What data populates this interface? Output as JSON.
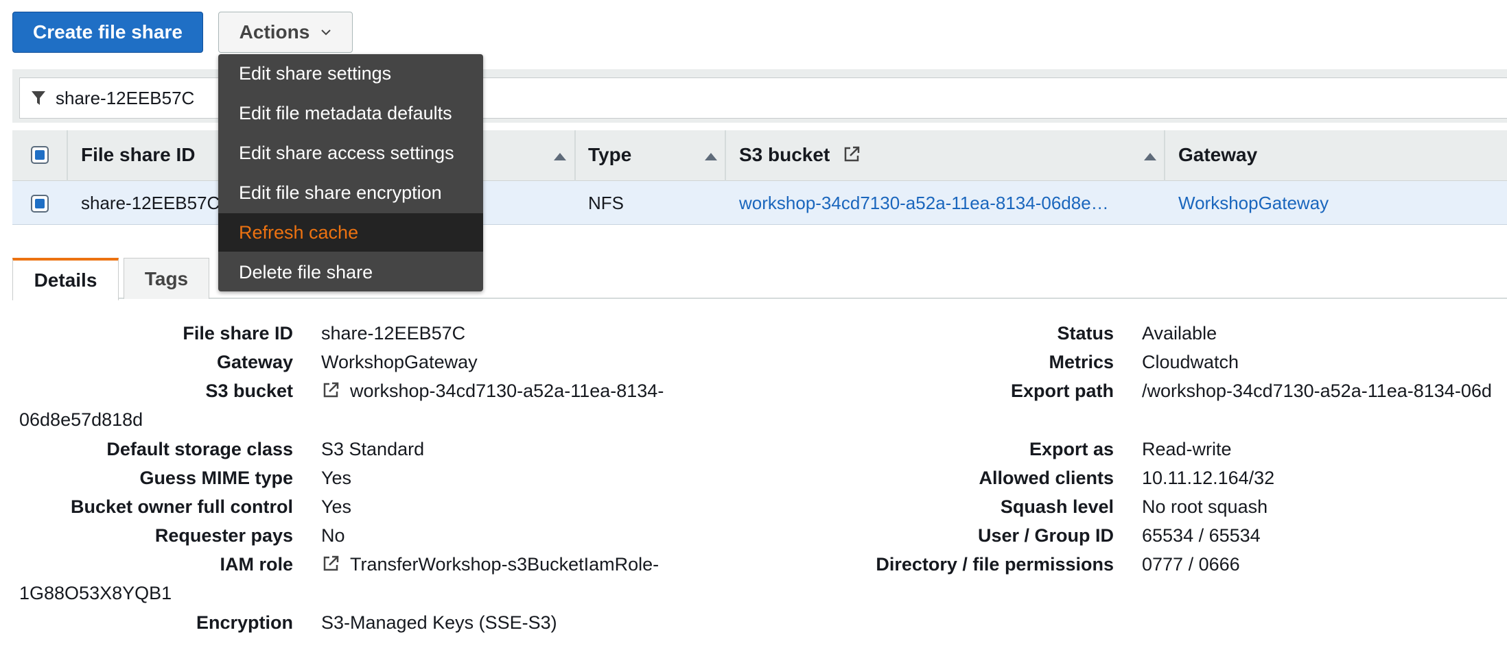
{
  "toolbar": {
    "create_label": "Create file share",
    "actions_label": "Actions"
  },
  "filter": {
    "value": "share-12EEB57C"
  },
  "table": {
    "headers": [
      "File share ID",
      "Type",
      "S3 bucket",
      "Gateway"
    ],
    "row": {
      "file_share_id": "share-12EEB57C",
      "type": "NFS",
      "s3_bucket": "workshop-34cd7130-a52a-11ea-8134-06d8e…",
      "gateway": "WorkshopGateway"
    }
  },
  "menu": {
    "items": [
      "Edit share settings",
      "Edit file metadata defaults",
      "Edit share access settings",
      "Edit file share encryption",
      "Refresh cache",
      "Delete file share"
    ],
    "highlighted_color": "#ec7211"
  },
  "tabs": [
    "Details",
    "Tags"
  ],
  "details": {
    "left": {
      "file_share_id": {
        "label": "File share ID",
        "value": "share-12EEB57C"
      },
      "gateway": {
        "label": "Gateway",
        "value": "WorkshopGateway"
      },
      "s3_bucket": {
        "label": "S3 bucket",
        "value_line1": "workshop-34cd7130-a52a-11ea-8134-",
        "value_line2": "06d8e57d818d"
      },
      "storage_class": {
        "label": "Default storage class",
        "value": "S3 Standard"
      },
      "guess_mime": {
        "label": "Guess MIME type",
        "value": "Yes"
      },
      "bucket_owner": {
        "label": "Bucket owner full control",
        "value": "Yes"
      },
      "requester_pays": {
        "label": "Requester pays",
        "value": "No"
      },
      "iam_role": {
        "label": "IAM role",
        "value_line1": "TransferWorkshop-s3BucketIamRole-",
        "value_line2": "1G88O53X8YQB1"
      },
      "encryption": {
        "label": "Encryption",
        "value": "S3-Managed Keys (SSE-S3)"
      }
    },
    "right": {
      "status": {
        "label": "Status",
        "value": "Available"
      },
      "metrics": {
        "label": "Metrics",
        "value": "Cloudwatch"
      },
      "export_path": {
        "label": "Export path",
        "value": "/workshop-34cd7130-a52a-11ea-8134-06d"
      },
      "export_as": {
        "label": "Export as",
        "value": "Read-write"
      },
      "allowed_clients": {
        "label": "Allowed clients",
        "value": "10.11.12.164/32"
      },
      "squash_level": {
        "label": "Squash level",
        "value": "No root squash"
      },
      "user_group_id": {
        "label": "User / Group ID",
        "value": "65534 / 65534"
      },
      "permissions": {
        "label": "Directory / file permissions",
        "value": "0777 / 0666"
      }
    }
  },
  "colors": {
    "primary": "#1f6fc5",
    "link": "#1a66bd",
    "accent": "#ec7211"
  }
}
